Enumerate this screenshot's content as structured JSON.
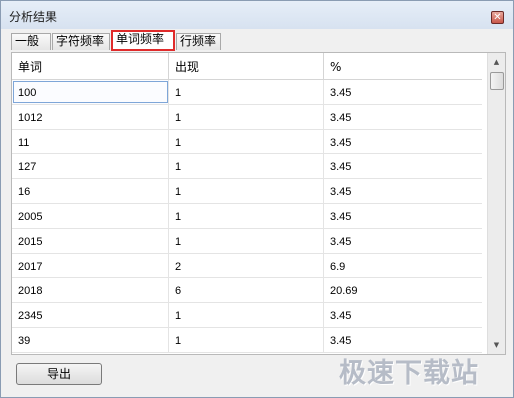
{
  "window": {
    "title": "分析结果",
    "close_glyph": "✕"
  },
  "tabs": [
    {
      "label": "一般",
      "active": false
    },
    {
      "label": "字符频率",
      "active": false
    },
    {
      "label": "单词频率",
      "active": true
    },
    {
      "label": "行频率",
      "active": false
    }
  ],
  "table": {
    "columns": [
      "单词",
      "出现",
      "%"
    ],
    "rows": [
      [
        "100",
        "1",
        "3.45"
      ],
      [
        "1012",
        "1",
        "3.45"
      ],
      [
        "11",
        "1",
        "3.45"
      ],
      [
        "127",
        "1",
        "3.45"
      ],
      [
        "16",
        "1",
        "3.45"
      ],
      [
        "2005",
        "1",
        "3.45"
      ],
      [
        "2015",
        "1",
        "3.45"
      ],
      [
        "2017",
        "2",
        "6.9"
      ],
      [
        "2018",
        "6",
        "20.69"
      ],
      [
        "2345",
        "1",
        "3.45"
      ],
      [
        "39",
        "1",
        "3.45"
      ]
    ]
  },
  "footer": {
    "export_label": "导出"
  },
  "watermark": "极速下载站",
  "colors": {
    "active_tab_border": "#e02b2b",
    "close_button": "#c9574a"
  }
}
